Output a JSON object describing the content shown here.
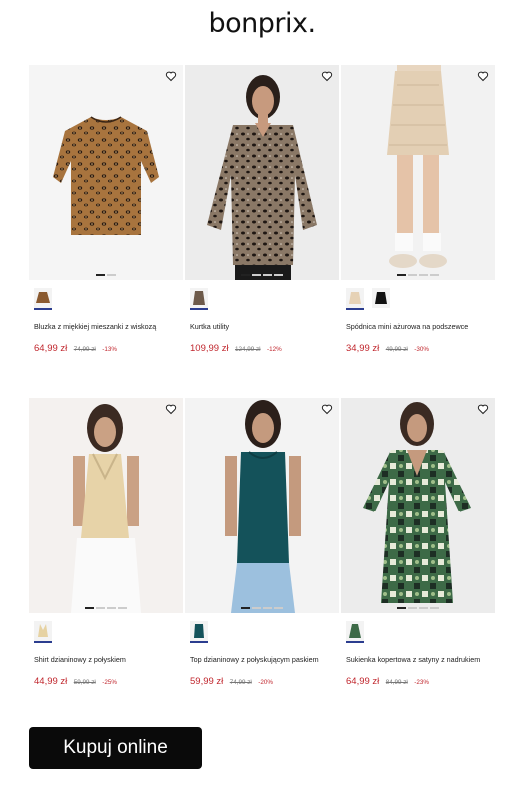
{
  "brand": {
    "logo_text": "bonprix."
  },
  "products": [
    {
      "name": "Bluzka z miękkiej mieszanki z wiskozą",
      "price": "64,99 zł",
      "old_price": "74,99 zł",
      "discount": "-13%",
      "bg": "#f4f4f4"
    },
    {
      "name": "Kurtka utility",
      "price": "109,99 zł",
      "old_price": "124,99 zł",
      "discount": "-12%",
      "bg": "#efefef"
    },
    {
      "name": "Spódnica mini ażurowa na podszewce",
      "price": "34,99 zł",
      "old_price": "49,99 zł",
      "discount": "-30%",
      "bg": "#f2f2f2"
    },
    {
      "name": "Shirt dzianinowy z połyskiem",
      "price": "44,99 zł",
      "old_price": "59,99 zł",
      "discount": "-25%",
      "bg": "#f1f1f1"
    },
    {
      "name": "Top dzianinowy z połyskującym paskiem",
      "price": "59,99 zł",
      "old_price": "74,99 zł",
      "discount": "-20%",
      "bg": "#f3f3f3"
    },
    {
      "name": "Sukienka kopertowa z satyny z nadrukiem",
      "price": "64,99 zł",
      "old_price": "84,99 zł",
      "discount": "-23%",
      "bg": "#efefef"
    }
  ],
  "cta": {
    "label": "Kupuj online"
  },
  "icons": {
    "wishlist": "heart-outline-icon"
  }
}
